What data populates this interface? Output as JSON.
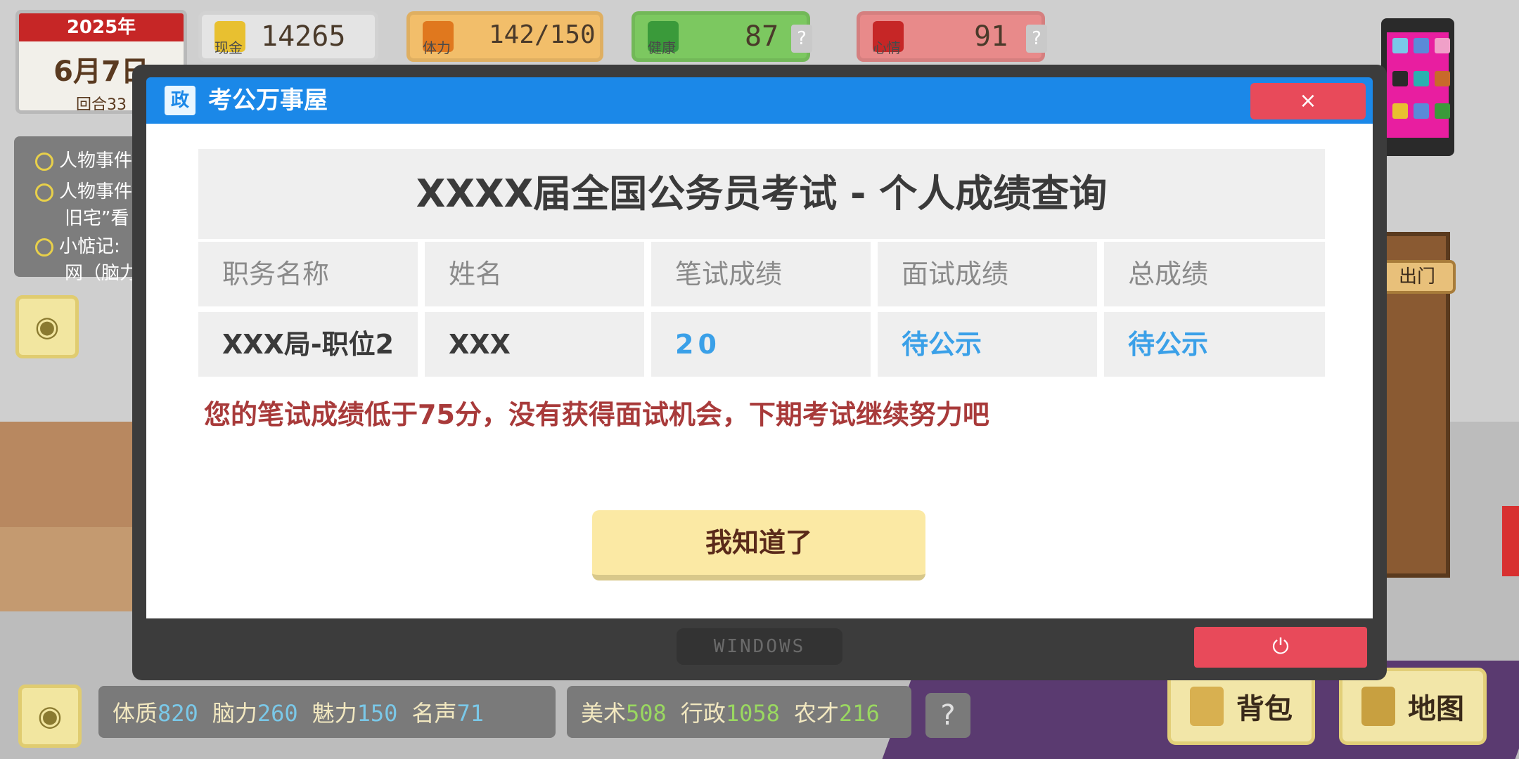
{
  "date": {
    "year": "2025年",
    "day": "6月7日",
    "round": "回合33"
  },
  "stats": {
    "cash": {
      "label": "现金",
      "value": "14265"
    },
    "stamina": {
      "label": "体力",
      "value": "142/150"
    },
    "health": {
      "label": "健康",
      "value": "87",
      "help": "?"
    },
    "mood": {
      "label": "心情",
      "value": "91",
      "help": "?"
    }
  },
  "quests": [
    {
      "text": "人物事件"
    },
    {
      "text": "人物事件"
    },
    {
      "text": "旧宅”看"
    },
    {
      "text": "小惦记:"
    },
    {
      "text": "网（脑力"
    }
  ],
  "exit_label": "出门",
  "window": {
    "logo": "政",
    "title": "考公万事屋",
    "close": "×",
    "exam_title": "XXXX届全国公务员考试 - 个人成绩查询",
    "table": {
      "headers": [
        "职务名称",
        "姓名",
        "笔试成绩",
        "面试成绩",
        "总成绩"
      ],
      "row": [
        "XXX局-职位2",
        "XXX",
        "20",
        "待公示",
        "待公示"
      ]
    },
    "notice": "您的笔试成绩低于75分，没有获得面试机会，下期考试继续努力吧",
    "ok_button": "我知道了",
    "taskbar": "WINDOWS",
    "power": "⏻"
  },
  "attributes": {
    "group1": [
      {
        "label": "体质",
        "value": "820"
      },
      {
        "label": "脑力",
        "value": "260"
      },
      {
        "label": "魅力",
        "value": "150"
      },
      {
        "label": "名声",
        "value": "71"
      }
    ],
    "group2": [
      {
        "label": "美术",
        "value": "508"
      },
      {
        "label": "行政",
        "value": "1058"
      },
      {
        "label": "农才",
        "value": "216"
      }
    ],
    "help": "?"
  },
  "buttons": {
    "bag": "背包",
    "map": "地图"
  },
  "colors": {
    "title_bar": "#1b88e8",
    "close": "#e84a5a",
    "notice": "#a83a3a",
    "status_blue": "#3aa0e8",
    "ok_button": "#fbe9a4"
  }
}
